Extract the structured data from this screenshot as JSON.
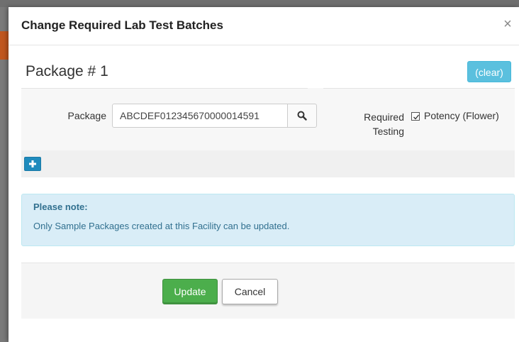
{
  "modal": {
    "title": "Change Required Lab Test Batches",
    "close_label": "×"
  },
  "package_section": {
    "title": "Package # 1",
    "clear_label": "(clear)",
    "package_label": "Package",
    "package_value": "ABCDEF012345670000014591",
    "search_icon": "search-icon",
    "required_testing_label": "Required Testing",
    "required_testing_option": "Potency (Flower)",
    "required_testing_checked": true
  },
  "add_button": {
    "icon": "plus-icon"
  },
  "note": {
    "title": "Please note:",
    "text": "Only Sample Packages created at this Facility can be updated."
  },
  "footer": {
    "update_label": "Update",
    "cancel_label": "Cancel"
  },
  "colors": {
    "info_button": "#5bc0de",
    "primary_add": "#1f8bbd",
    "success_button": "#4cae4c",
    "note_bg": "#d9edf7",
    "note_text": "#31708f"
  }
}
